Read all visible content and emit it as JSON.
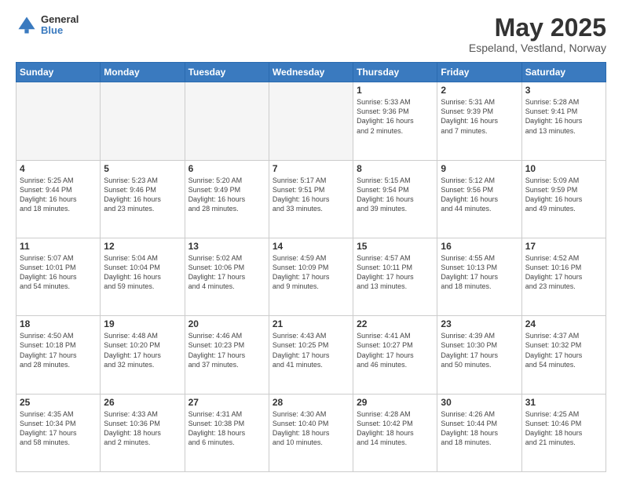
{
  "header": {
    "logo": {
      "general": "General",
      "blue": "Blue"
    },
    "title": "May 2025",
    "subtitle": "Espeland, Vestland, Norway"
  },
  "weekdays": [
    "Sunday",
    "Monday",
    "Tuesday",
    "Wednesday",
    "Thursday",
    "Friday",
    "Saturday"
  ],
  "weeks": [
    [
      {
        "day": "",
        "info": ""
      },
      {
        "day": "",
        "info": ""
      },
      {
        "day": "",
        "info": ""
      },
      {
        "day": "",
        "info": ""
      },
      {
        "day": "1",
        "info": "Sunrise: 5:33 AM\nSunset: 9:36 PM\nDaylight: 16 hours\nand 2 minutes."
      },
      {
        "day": "2",
        "info": "Sunrise: 5:31 AM\nSunset: 9:39 PM\nDaylight: 16 hours\nand 7 minutes."
      },
      {
        "day": "3",
        "info": "Sunrise: 5:28 AM\nSunset: 9:41 PM\nDaylight: 16 hours\nand 13 minutes."
      }
    ],
    [
      {
        "day": "4",
        "info": "Sunrise: 5:25 AM\nSunset: 9:44 PM\nDaylight: 16 hours\nand 18 minutes."
      },
      {
        "day": "5",
        "info": "Sunrise: 5:23 AM\nSunset: 9:46 PM\nDaylight: 16 hours\nand 23 minutes."
      },
      {
        "day": "6",
        "info": "Sunrise: 5:20 AM\nSunset: 9:49 PM\nDaylight: 16 hours\nand 28 minutes."
      },
      {
        "day": "7",
        "info": "Sunrise: 5:17 AM\nSunset: 9:51 PM\nDaylight: 16 hours\nand 33 minutes."
      },
      {
        "day": "8",
        "info": "Sunrise: 5:15 AM\nSunset: 9:54 PM\nDaylight: 16 hours\nand 39 minutes."
      },
      {
        "day": "9",
        "info": "Sunrise: 5:12 AM\nSunset: 9:56 PM\nDaylight: 16 hours\nand 44 minutes."
      },
      {
        "day": "10",
        "info": "Sunrise: 5:09 AM\nSunset: 9:59 PM\nDaylight: 16 hours\nand 49 minutes."
      }
    ],
    [
      {
        "day": "11",
        "info": "Sunrise: 5:07 AM\nSunset: 10:01 PM\nDaylight: 16 hours\nand 54 minutes."
      },
      {
        "day": "12",
        "info": "Sunrise: 5:04 AM\nSunset: 10:04 PM\nDaylight: 16 hours\nand 59 minutes."
      },
      {
        "day": "13",
        "info": "Sunrise: 5:02 AM\nSunset: 10:06 PM\nDaylight: 17 hours\nand 4 minutes."
      },
      {
        "day": "14",
        "info": "Sunrise: 4:59 AM\nSunset: 10:09 PM\nDaylight: 17 hours\nand 9 minutes."
      },
      {
        "day": "15",
        "info": "Sunrise: 4:57 AM\nSunset: 10:11 PM\nDaylight: 17 hours\nand 13 minutes."
      },
      {
        "day": "16",
        "info": "Sunrise: 4:55 AM\nSunset: 10:13 PM\nDaylight: 17 hours\nand 18 minutes."
      },
      {
        "day": "17",
        "info": "Sunrise: 4:52 AM\nSunset: 10:16 PM\nDaylight: 17 hours\nand 23 minutes."
      }
    ],
    [
      {
        "day": "18",
        "info": "Sunrise: 4:50 AM\nSunset: 10:18 PM\nDaylight: 17 hours\nand 28 minutes."
      },
      {
        "day": "19",
        "info": "Sunrise: 4:48 AM\nSunset: 10:20 PM\nDaylight: 17 hours\nand 32 minutes."
      },
      {
        "day": "20",
        "info": "Sunrise: 4:46 AM\nSunset: 10:23 PM\nDaylight: 17 hours\nand 37 minutes."
      },
      {
        "day": "21",
        "info": "Sunrise: 4:43 AM\nSunset: 10:25 PM\nDaylight: 17 hours\nand 41 minutes."
      },
      {
        "day": "22",
        "info": "Sunrise: 4:41 AM\nSunset: 10:27 PM\nDaylight: 17 hours\nand 46 minutes."
      },
      {
        "day": "23",
        "info": "Sunrise: 4:39 AM\nSunset: 10:30 PM\nDaylight: 17 hours\nand 50 minutes."
      },
      {
        "day": "24",
        "info": "Sunrise: 4:37 AM\nSunset: 10:32 PM\nDaylight: 17 hours\nand 54 minutes."
      }
    ],
    [
      {
        "day": "25",
        "info": "Sunrise: 4:35 AM\nSunset: 10:34 PM\nDaylight: 17 hours\nand 58 minutes."
      },
      {
        "day": "26",
        "info": "Sunrise: 4:33 AM\nSunset: 10:36 PM\nDaylight: 18 hours\nand 2 minutes."
      },
      {
        "day": "27",
        "info": "Sunrise: 4:31 AM\nSunset: 10:38 PM\nDaylight: 18 hours\nand 6 minutes."
      },
      {
        "day": "28",
        "info": "Sunrise: 4:30 AM\nSunset: 10:40 PM\nDaylight: 18 hours\nand 10 minutes."
      },
      {
        "day": "29",
        "info": "Sunrise: 4:28 AM\nSunset: 10:42 PM\nDaylight: 18 hours\nand 14 minutes."
      },
      {
        "day": "30",
        "info": "Sunrise: 4:26 AM\nSunset: 10:44 PM\nDaylight: 18 hours\nand 18 minutes."
      },
      {
        "day": "31",
        "info": "Sunrise: 4:25 AM\nSunset: 10:46 PM\nDaylight: 18 hours\nand 21 minutes."
      }
    ]
  ]
}
